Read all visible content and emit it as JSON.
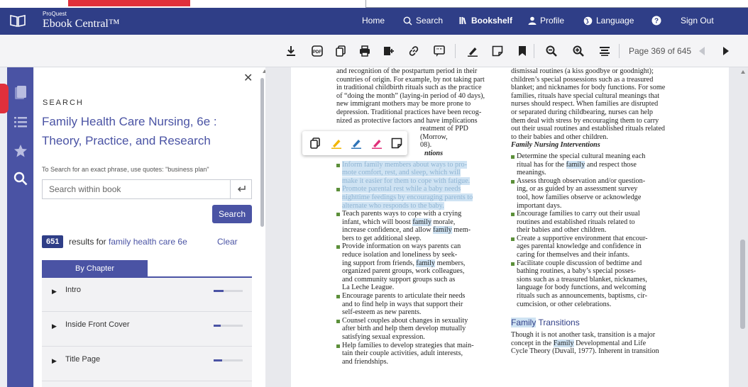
{
  "brand": {
    "small": "ProQuest",
    "name": "Ebook Central™",
    "icon": "open-book-icon"
  },
  "nav": {
    "home": "Home",
    "search": "Search",
    "bookshelf": "Bookshelf",
    "profile": "Profile",
    "language": "Language",
    "help_icon": "help-circle-icon",
    "signout": "Sign Out"
  },
  "toolbar": {
    "icons": [
      "download-icon",
      "pdf-icon",
      "copy-icon",
      "print-icon",
      "add-to-list-icon",
      "link-icon",
      "citation-icon",
      "highlight-pen-icon",
      "note-icon",
      "bookmark-icon",
      "zoom-out-icon",
      "zoom-in-icon",
      "full-width-icon"
    ],
    "page_indicator": "Page 369 of 645"
  },
  "rail": {
    "icons": [
      "table-of-contents-icon",
      "list-icon",
      "star-icon",
      "search-icon"
    ]
  },
  "search_panel": {
    "heading": "SEARCH",
    "book_title": "Family Health Care Nursing, 6e : Theory, Practice, and Research",
    "hint": "To Search for an exact phrase, use quotes: \"business plan\"",
    "placeholder": "Search within book",
    "search_button": "Search",
    "result_count": "651",
    "results_for": "results for",
    "query": "family health care 6e",
    "clear": "Clear",
    "tab": "By Chapter",
    "chapters": [
      {
        "label": "Intro",
        "relevance": 0.35
      },
      {
        "label": "Inside Front Cover",
        "relevance": 0.25
      },
      {
        "label": "Title Page",
        "relevance": 0.3
      }
    ]
  },
  "page_text": {
    "left_top": [
      "and recognition of the postpartum period in their",
      "countries of origin. For example, by not taking part",
      "in traditional childbirth rituals such as the practice",
      "of “doing the month” (laying-in period of 40 days),",
      "new immigrant mothers may be more prone to",
      "depression. Traditional practices have been recog-",
      "nized as protective factors and have implications"
    ],
    "left_partial_1": "reatment of PPD (Morrow,",
    "left_partial_2": "08).",
    "left_partial_3": "ntions",
    "left_hl_1a": "Inform ",
    "left_hl_1w": "family",
    "left_hl_1b": " members about ways to pro-",
    "left_hl_lines": [
      "mote comfort, rest, and sleep, which will",
      "make it easier for them to cope with fatigue."
    ],
    "left_hl_2": [
      "Promote parental rest while a baby needs",
      "nighttime feedings by encouraging parents to",
      "alternate who responds to the baby."
    ],
    "left_b3a": "Teach parents ways to cope with a crying",
    "left_b3b1": "infant, which will boost ",
    "left_b3b2": "family",
    "left_b3b3": " morale,",
    "left_b3c1": "increase confidence, and allow ",
    "left_b3c2": "family",
    "left_b3c3": " mem-",
    "left_b3d": "bers to get additional sleep.",
    "left_b4a": "Provide information on ways parents can",
    "left_b4b": "reduce isolation and loneliness by seek-",
    "left_b4c1": "ing support from friends, ",
    "left_b4c2": "family",
    "left_b4c3": " members,",
    "left_b4d": "organized parent groups, work colleagues,",
    "left_b4e": "and community support groups such as",
    "left_b4f": "La Leche League.",
    "left_b5": [
      "Encourage parents to articulate their needs",
      "and to find help in ways that support their",
      "self-esteem as new parents."
    ],
    "left_b6": [
      "Counsel couples about changes in sexuality",
      "after birth and help them develop mutually",
      "satisfying sexual expression."
    ],
    "left_b7": [
      "Help families to develop strategies that main-",
      "tain their couple activities, adult interests,",
      "and friendships."
    ],
    "right_top": [
      "dismissal routines (a kiss goodbye or goodnight);",
      "children’s special possessions such as a treasured",
      "blanket; and nicknames for body functions. For some",
      "families, rituals have special cultural meanings that",
      "nurses should respect. When families are disrupted",
      "or separated during childbearing, nurses can help",
      "them deal with stress by encouraging them to carry",
      "out their usual routines and established rituals related",
      "to their babies and other children."
    ],
    "right_head1": "Family Nursing Interventions",
    "right_b1a": "Determine the special cultural meaning each",
    "right_b1b1": "ritual has for the ",
    "right_b1b2": "family",
    "right_b1b3": " and respect those",
    "right_b1c": "meanings.",
    "right_b2": [
      "Assess through observation and/or question-",
      "ing, or as guided by an assessment survey",
      "tool, how families observe or acknowledge",
      "important days."
    ],
    "right_b3": [
      "Encourage families to carry out their usual",
      "routines and established rituals related to",
      "their babies and other children."
    ],
    "right_b4": [
      "Create a supportive environment that encour-",
      "ages parental knowledge and confidence in",
      "caring for themselves and their infants."
    ],
    "right_b5": [
      "Facilitate couple discussion of bedtime and",
      "bathing routines, a baby’s special posses-",
      "sions such as a treasured blanket, nicknames,",
      "language for body functions, and welcoming",
      "rituals such as announcements, baptisms, cir-",
      "cumcision, or other celebrations."
    ],
    "right_head2a": "Family",
    "right_head2b": " Transitions",
    "right_p1": "Though it is not another task, transition is a major",
    "right_p2a": "concept in the ",
    "right_p2b": "Family",
    "right_p2c": " Developmental and Life",
    "right_p3": "Cycle Theory (Duvall, 1977). Inherent in transition"
  },
  "popup": {
    "icons": [
      "copy-icon",
      "highlight-yellow-icon",
      "highlight-blue-icon",
      "highlight-pink-icon",
      "note-icon"
    ]
  }
}
